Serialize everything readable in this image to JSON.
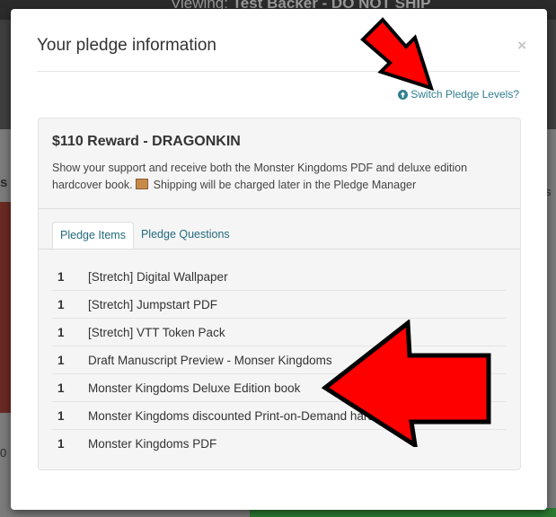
{
  "background": {
    "topbar_label": "Viewing:",
    "topbar_value": "Test Backer - DO NOT SHIP",
    "left_char": "s",
    "left_bottom_char": "0",
    "right_char": "s"
  },
  "modal": {
    "title": "Your pledge information",
    "close_label": "×",
    "switch_link": "Switch Pledge Levels?",
    "reward": {
      "title": "$110 Reward - DRAGONKIN",
      "description": "Show your support and receive both the Monster Kingdoms PDF and deluxe edition hardcover book.",
      "shipping_note": "Shipping will be charged later in the Pledge Manager"
    },
    "tabs": [
      {
        "label": "Pledge Items"
      },
      {
        "label": "Pledge Questions"
      }
    ],
    "items": [
      {
        "qty": "1",
        "name": "[Stretch] Digital Wallpaper"
      },
      {
        "qty": "1",
        "name": "[Stretch] Jumpstart PDF"
      },
      {
        "qty": "1",
        "name": "[Stretch] VTT Token Pack"
      },
      {
        "qty": "1",
        "name": "Draft Manuscript Preview - Monser Kingdoms"
      },
      {
        "qty": "1",
        "name": "Monster Kingdoms Deluxe Edition book"
      },
      {
        "qty": "1",
        "name": "Monster Kingdoms discounted Print-on-Demand hardcover book"
      },
      {
        "qty": "1",
        "name": "Monster Kingdoms PDF"
      }
    ]
  },
  "colors": {
    "link": "#2f7f8f",
    "arrow_fill": "#ff0000",
    "arrow_outline": "#000000"
  }
}
